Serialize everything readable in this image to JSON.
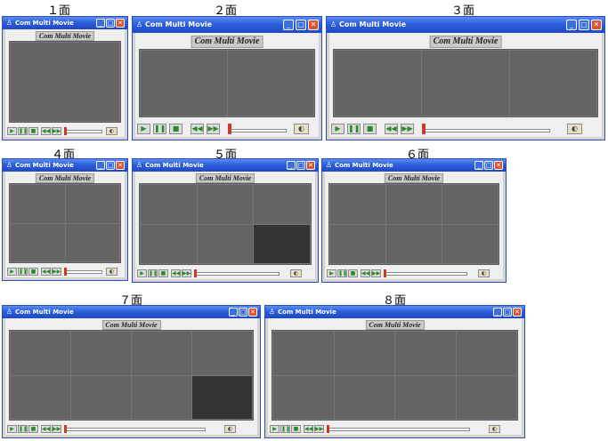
{
  "colors": {
    "titlebar": "#2c5fdc",
    "video_cell": "#646464",
    "video_cell_empty": "#343434",
    "window_frame": "#d6d3ce",
    "close_button": "#d9532c"
  },
  "window_title": "Com Multi Movie",
  "caption": "Com Multi Movie",
  "icons": {
    "app": "camera-icon",
    "minimize": "minimize-icon",
    "maximize": "maximize-icon",
    "close": "close-icon",
    "play": "play-icon",
    "pause": "pause-icon",
    "stop": "stop-icon",
    "rewind": "rewind-icon",
    "fast_forward": "fast-forward-icon",
    "volume": "volume-icon"
  },
  "glyphs": {
    "app": "♙",
    "minimize": "_",
    "maximize": "□",
    "close": "✕",
    "play": "▶",
    "pause": "❚❚",
    "stop": "■",
    "rewind": "◀◀",
    "fast_forward": "▶▶",
    "volume": "◐"
  },
  "panels": [
    {
      "label": "１面",
      "cells": 1,
      "empty_cells": []
    },
    {
      "label": "２面",
      "cells": 2,
      "empty_cells": []
    },
    {
      "label": "３面",
      "cells": 3,
      "empty_cells": []
    },
    {
      "label": "４面",
      "cells": 4,
      "empty_cells": []
    },
    {
      "label": "５面",
      "cells": 6,
      "empty_cells": [
        5
      ]
    },
    {
      "label": "６面",
      "cells": 6,
      "empty_cells": []
    },
    {
      "label": "７面",
      "cells": 8,
      "empty_cells": [
        7
      ]
    },
    {
      "label": "８面",
      "cells": 8,
      "empty_cells": []
    }
  ]
}
